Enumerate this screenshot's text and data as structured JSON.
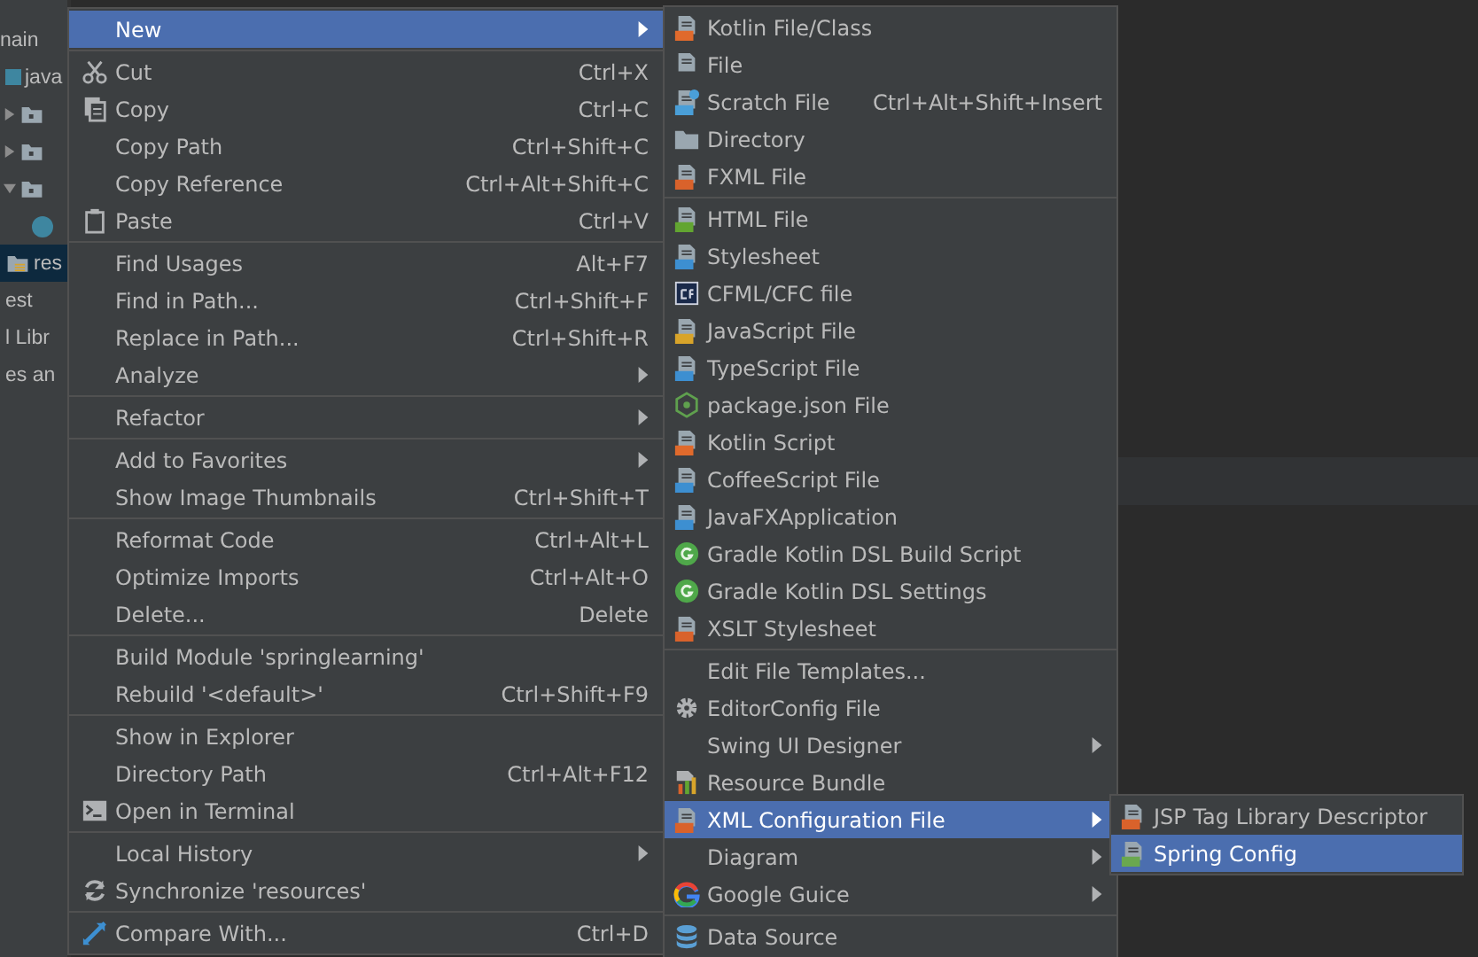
{
  "project_tree": [
    {
      "label": "nain",
      "kind": "plain",
      "selected": false
    },
    {
      "label": "java",
      "kind": "source",
      "selected": false,
      "children": [
        {
          "kind": "package",
          "selected": false,
          "expanded": false
        },
        {
          "kind": "package",
          "selected": false,
          "expanded": false
        },
        {
          "kind": "package",
          "selected": false,
          "expanded": true,
          "children": [
            {
              "kind": "class",
              "selected": false
            }
          ]
        }
      ]
    },
    {
      "label": "res",
      "kind": "resources",
      "selected": true
    },
    {
      "label": "est",
      "kind": "plain",
      "selected": false
    },
    {
      "label": "l Libr",
      "kind": "plain",
      "selected": false
    },
    {
      "label": "es an",
      "kind": "plain",
      "selected": false
    }
  ],
  "context_menu": [
    {
      "items": [
        {
          "label": "New",
          "kind": "plain",
          "selected": true,
          "submenu": true
        }
      ]
    },
    {
      "items": [
        {
          "label": "Cut",
          "shortcut": "Ctrl+X",
          "kind": "scissors",
          "selected": false,
          "submenu": false
        },
        {
          "label": "Copy",
          "shortcut": "Ctrl+C",
          "kind": "copy",
          "selected": false,
          "submenu": false
        },
        {
          "label": "Copy Path",
          "shortcut": "Ctrl+Shift+C",
          "kind": "plain",
          "selected": false,
          "submenu": false
        },
        {
          "label": "Copy Reference",
          "shortcut": "Ctrl+Alt+Shift+C",
          "kind": "plain",
          "selected": false,
          "submenu": false
        },
        {
          "label": "Paste",
          "shortcut": "Ctrl+V",
          "kind": "clipboard",
          "selected": false,
          "submenu": false
        }
      ]
    },
    {
      "items": [
        {
          "label": "Find Usages",
          "shortcut": "Alt+F7",
          "kind": "plain",
          "selected": false,
          "submenu": false
        },
        {
          "label": "Find in Path...",
          "shortcut": "Ctrl+Shift+F",
          "kind": "plain",
          "selected": false,
          "submenu": false
        },
        {
          "label": "Replace in Path...",
          "shortcut": "Ctrl+Shift+R",
          "kind": "plain",
          "selected": false,
          "submenu": false
        },
        {
          "label": "Analyze",
          "kind": "plain",
          "selected": false,
          "submenu": true
        }
      ]
    },
    {
      "items": [
        {
          "label": "Refactor",
          "kind": "plain",
          "selected": false,
          "submenu": true
        }
      ]
    },
    {
      "items": [
        {
          "label": "Add to Favorites",
          "kind": "plain",
          "selected": false,
          "submenu": true
        },
        {
          "label": "Show Image Thumbnails",
          "shortcut": "Ctrl+Shift+T",
          "kind": "plain",
          "selected": false,
          "submenu": false
        }
      ]
    },
    {
      "items": [
        {
          "label": "Reformat Code",
          "shortcut": "Ctrl+Alt+L",
          "kind": "plain",
          "selected": false,
          "submenu": false
        },
        {
          "label": "Optimize Imports",
          "shortcut": "Ctrl+Alt+O",
          "kind": "plain",
          "selected": false,
          "submenu": false
        },
        {
          "label": "Delete...",
          "shortcut": "Delete",
          "kind": "plain",
          "selected": false,
          "submenu": false
        }
      ]
    },
    {
      "items": [
        {
          "label": "Build Module 'springlearning'",
          "kind": "plain",
          "selected": false,
          "submenu": false
        },
        {
          "label": "Rebuild '<default>'",
          "shortcut": "Ctrl+Shift+F9",
          "kind": "plain",
          "selected": false,
          "submenu": false
        }
      ]
    },
    {
      "items": [
        {
          "label": "Show in Explorer",
          "kind": "plain",
          "selected": false,
          "submenu": false
        },
        {
          "label": "Directory Path",
          "shortcut": "Ctrl+Alt+F12",
          "kind": "plain",
          "selected": false,
          "submenu": false
        },
        {
          "label": "Open in Terminal",
          "kind": "terminal",
          "selected": false,
          "submenu": false
        }
      ]
    },
    {
      "items": [
        {
          "label": "Local History",
          "kind": "plain",
          "selected": false,
          "submenu": true
        },
        {
          "label": "Synchronize 'resources'",
          "kind": "sync",
          "selected": false,
          "submenu": false
        }
      ]
    },
    {
      "items": [
        {
          "label": "Compare With...",
          "shortcut": "Ctrl+D",
          "kind": "compare",
          "selected": false,
          "submenu": false
        }
      ]
    }
  ],
  "new_submenu": [
    {
      "items": [
        {
          "label": "Kotlin File/Class",
          "kind": "kotlin",
          "selected": false,
          "submenu": false
        },
        {
          "label": "File",
          "kind": "file",
          "selected": false,
          "submenu": false
        },
        {
          "label": "Scratch File",
          "shortcut": "Ctrl+Alt+Shift+Insert",
          "kind": "scratch",
          "selected": false,
          "submenu": false
        },
        {
          "label": "Directory",
          "kind": "folder",
          "selected": false,
          "submenu": false
        },
        {
          "label": "FXML File",
          "kind": "xml",
          "selected": false,
          "submenu": false
        }
      ]
    },
    {
      "items": [
        {
          "label": "HTML File",
          "kind": "html",
          "selected": false,
          "submenu": false
        },
        {
          "label": "Stylesheet",
          "kind": "css",
          "selected": false,
          "submenu": false
        },
        {
          "label": "CFML/CFC file",
          "kind": "cfml",
          "selected": false,
          "submenu": false
        },
        {
          "label": "JavaScript File",
          "kind": "js",
          "selected": false,
          "submenu": false
        },
        {
          "label": "TypeScript File",
          "kind": "ts",
          "selected": false,
          "submenu": false
        },
        {
          "label": "package.json File",
          "kind": "node",
          "selected": false,
          "submenu": false
        },
        {
          "label": "Kotlin Script",
          "kind": "kotlin",
          "selected": false,
          "submenu": false
        },
        {
          "label": "CoffeeScript File",
          "kind": "coffee",
          "selected": false,
          "submenu": false
        },
        {
          "label": "JavaFXApplication",
          "kind": "javafx",
          "selected": false,
          "submenu": false
        },
        {
          "label": "Gradle Kotlin DSL Build Script",
          "kind": "gradle",
          "selected": false,
          "submenu": false
        },
        {
          "label": "Gradle Kotlin DSL Settings",
          "kind": "gradle",
          "selected": false,
          "submenu": false
        },
        {
          "label": "XSLT Stylesheet",
          "kind": "xml",
          "selected": false,
          "submenu": false
        }
      ]
    },
    {
      "items": [
        {
          "label": "Edit File Templates...",
          "kind": "plain",
          "selected": false,
          "submenu": false
        },
        {
          "label": "EditorConfig File",
          "kind": "gear",
          "selected": false,
          "submenu": false
        },
        {
          "label": "Swing UI Designer",
          "kind": "plain",
          "selected": false,
          "submenu": true
        },
        {
          "label": "Resource Bundle",
          "kind": "bundle",
          "selected": false,
          "submenu": false
        },
        {
          "label": "XML Configuration File",
          "kind": "xml",
          "selected": true,
          "submenu": true
        },
        {
          "label": "Diagram",
          "kind": "plain",
          "selected": false,
          "submenu": true
        },
        {
          "label": "Google Guice",
          "kind": "google",
          "selected": false,
          "submenu": true
        }
      ]
    },
    {
      "items": [
        {
          "label": "Data Source",
          "kind": "database",
          "selected": false,
          "submenu": false
        }
      ]
    }
  ],
  "xml_submenu": [
    {
      "items": [
        {
          "label": "JSP Tag Library Descriptor",
          "kind": "xml",
          "selected": false,
          "submenu": false
        },
        {
          "label": "Spring Config",
          "kind": "spring",
          "selected": true,
          "submenu": false
        }
      ]
    }
  ]
}
